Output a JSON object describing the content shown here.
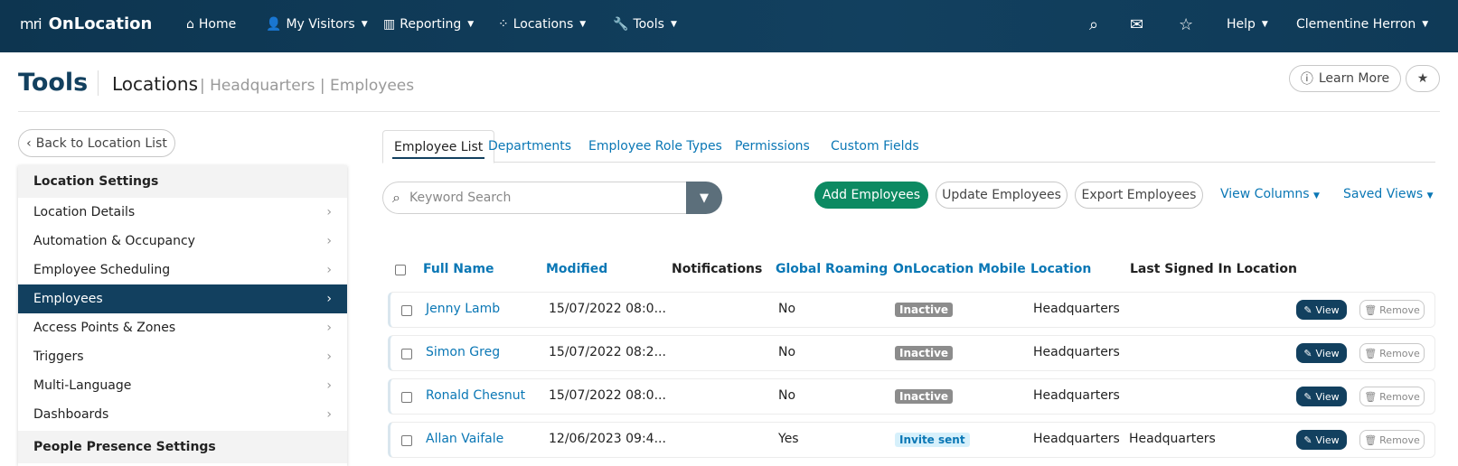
{
  "nav": {
    "brand_mark": "mri",
    "brand": "OnLocation",
    "home": "Home",
    "my_visitors": "My Visitors",
    "reporting": "Reporting",
    "locations": "Locations",
    "tools": "Tools",
    "help": "Help",
    "user": "Clementine Herron"
  },
  "header": {
    "title": "Tools",
    "crumb_main": "Locations",
    "crumb_rest": "| Headquarters | Employees",
    "learn_more": "Learn More"
  },
  "back_label": "Back to Location List",
  "sidebar": {
    "section1": "Location Settings",
    "items": [
      {
        "label": "Location Details"
      },
      {
        "label": "Automation & Occupancy"
      },
      {
        "label": "Employee Scheduling"
      },
      {
        "label": "Employees"
      },
      {
        "label": "Access Points & Zones"
      },
      {
        "label": "Triggers"
      },
      {
        "label": "Multi-Language"
      },
      {
        "label": "Dashboards"
      }
    ],
    "section2": "People Presence Settings"
  },
  "tabs": [
    "Employee List",
    "Departments",
    "Employee Role Types",
    "Permissions",
    "Custom Fields"
  ],
  "search": {
    "placeholder": "Keyword Search"
  },
  "toolbar": {
    "add": "Add Employees",
    "update": "Update Employees",
    "export": "Export Employees",
    "view_columns": "View Columns",
    "saved_views": "Saved Views"
  },
  "table": {
    "headers": [
      "Full Name",
      "Modified",
      "Notifications",
      "Global Roaming",
      "OnLocation Mobile",
      "Location",
      "Last Signed In Location"
    ],
    "rows": [
      {
        "name": "Jenny Lamb",
        "modified": "15/07/2022 08:0...",
        "notifications": "",
        "roaming": "No",
        "mobile": "Inactive",
        "location": "Headquarters",
        "last": ""
      },
      {
        "name": "Simon Greg",
        "modified": "15/07/2022 08:2...",
        "notifications": "",
        "roaming": "No",
        "mobile": "Inactive",
        "location": "Headquarters",
        "last": ""
      },
      {
        "name": "Ronald Chesnut",
        "modified": "15/07/2022 08:0...",
        "notifications": "",
        "roaming": "No",
        "mobile": "Inactive",
        "location": "Headquarters",
        "last": ""
      },
      {
        "name": "Allan Vaifale",
        "modified": "12/06/2023 09:4...",
        "notifications": "",
        "roaming": "Yes",
        "mobile": "Invite sent",
        "location": "Headquarters",
        "last": "Headquarters"
      }
    ],
    "view_label": "View",
    "remove_label": "Remove"
  },
  "colors": {
    "nav_bg": "#12405f",
    "accent_link": "#0a77b5",
    "add_green": "#0c8a62"
  }
}
